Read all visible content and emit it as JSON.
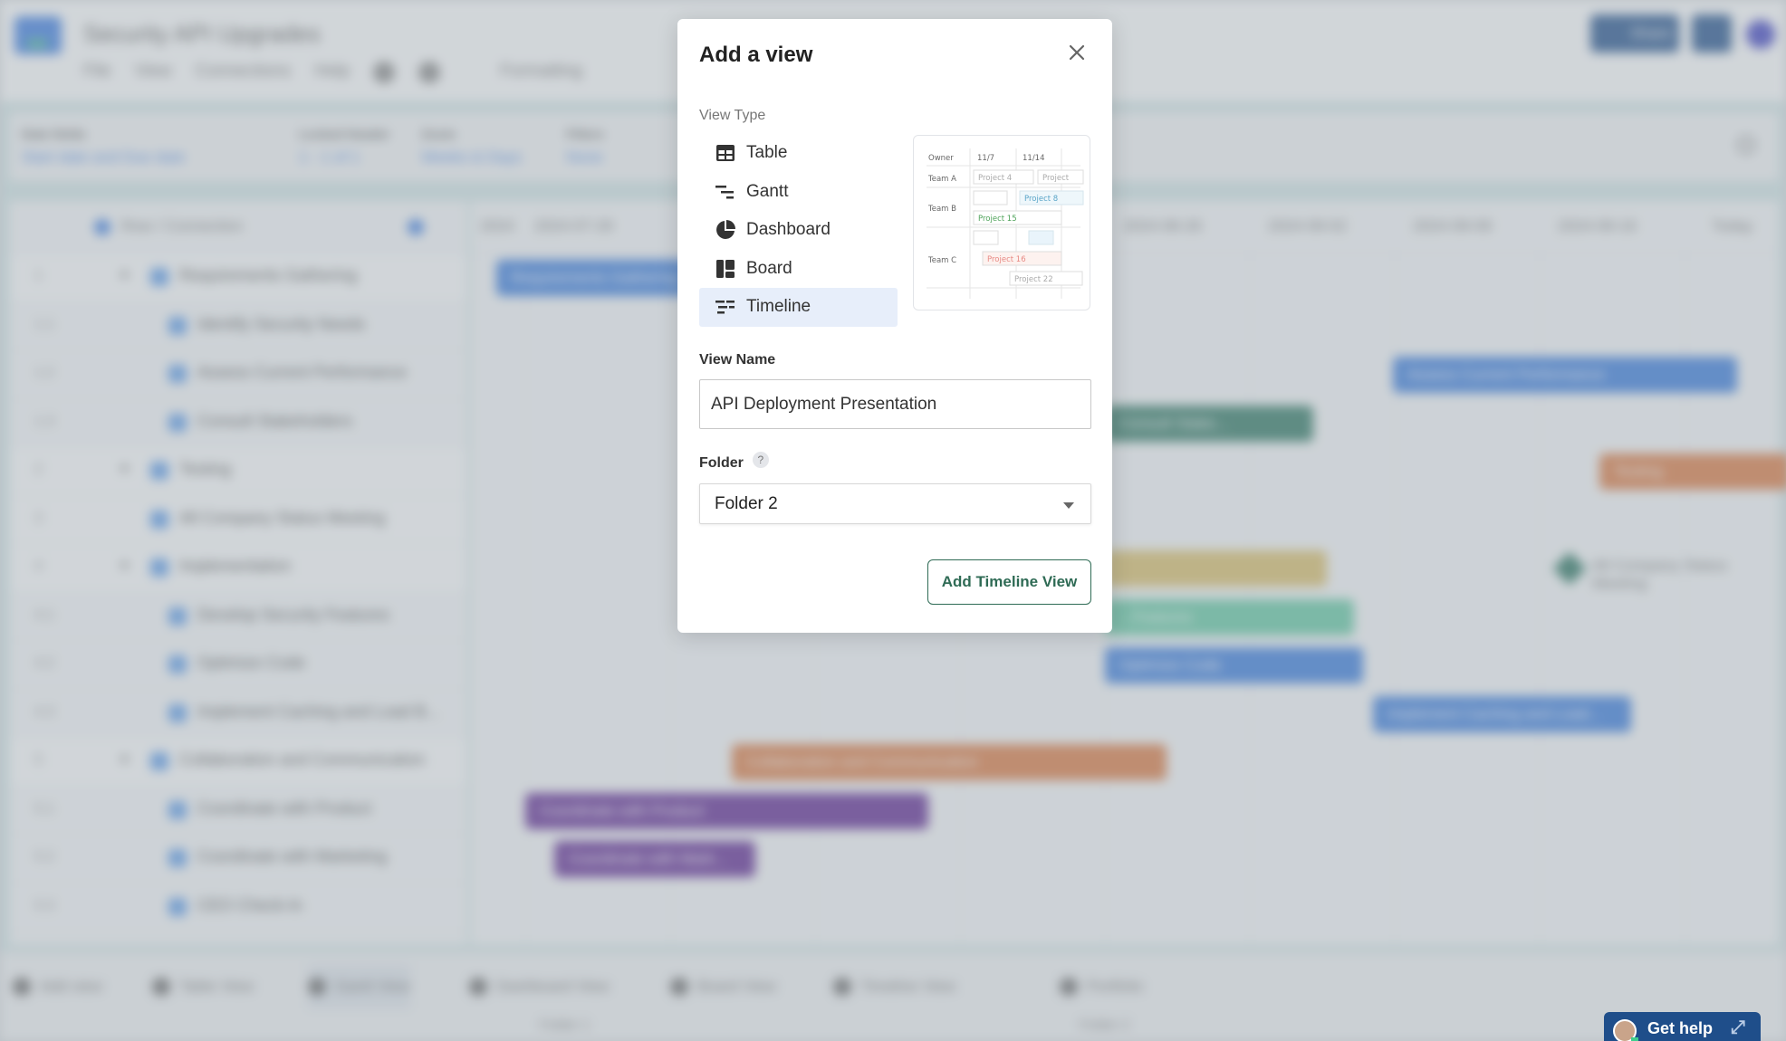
{
  "background": {
    "app_title": "Security API Upgrades",
    "menu": [
      "File",
      "View",
      "Connections",
      "Help"
    ],
    "toolbar": {
      "formatting_label": "Formatting"
    },
    "share_label": "Share",
    "filters": [
      {
        "label": "Date fields",
        "value": "Start date  and  Due date"
      },
      {
        "label": "Locked Header",
        "value": "1 - 1 of 1"
      },
      {
        "label": "Zoom",
        "value": "Weeks & Days"
      },
      {
        "label": "Filters",
        "value": "None"
      }
    ],
    "tasklist_header": "Row / Connection",
    "tasks": [
      {
        "num": "1",
        "name": "Requirements Gathering",
        "level": 0,
        "collapsible": true
      },
      {
        "num": "1.1",
        "name": "Identify Security Needs",
        "level": 1
      },
      {
        "num": "1.2",
        "name": "Assess Current Performance",
        "level": 1
      },
      {
        "num": "1.3",
        "name": "Consult Stakeholders",
        "level": 1
      },
      {
        "num": "2",
        "name": "Testing",
        "level": 0,
        "collapsible": true
      },
      {
        "num": "3",
        "name": "All Company Status Meeting",
        "level": 0
      },
      {
        "num": "4",
        "name": "Implementation",
        "level": 0,
        "collapsible": true
      },
      {
        "num": "4.1",
        "name": "Develop Security Features",
        "level": 1
      },
      {
        "num": "4.2",
        "name": "Optimize Code",
        "level": 1
      },
      {
        "num": "4.3",
        "name": "Implement Caching and Load B...",
        "level": 1
      },
      {
        "num": "5",
        "name": "Collaboration and Communication",
        "level": 0,
        "collapsible": true
      },
      {
        "num": "5.1",
        "name": "Coordinate with Product",
        "level": 1
      },
      {
        "num": "5.2",
        "name": "Coordinate with Marketing",
        "level": 1
      },
      {
        "num": "5.3",
        "name": "CEO Check-In",
        "level": 1
      }
    ],
    "gantt_dates": [
      "2024",
      "2024-07-29",
      "2024-08-26",
      "2024-09-02",
      "2024-09-09",
      "2024-09-16"
    ],
    "today_label": "Today",
    "bars": [
      {
        "label": "Requirements Gathering",
        "color": "#3478db"
      },
      {
        "label": "Assess Current Performance",
        "color": "#3478db"
      },
      {
        "label": "Consult Stake...",
        "color": "#2b7560"
      },
      {
        "label": "Testing",
        "color": "#d9773f"
      },
      {
        "label": "All Company Status Meeting",
        "color": "#2b7560"
      },
      {
        "label": "",
        "color": "#d8bc67"
      },
      {
        "label": "...Features",
        "color": "#5fc6a0"
      },
      {
        "label": "Optimize Code",
        "color": "#3478db"
      },
      {
        "label": "Implement Caching and Load...",
        "color": "#3478db"
      },
      {
        "label": "Collaboration and Communication",
        "color": "#d9773f"
      },
      {
        "label": "Coordinate with Product",
        "color": "#5b2390"
      },
      {
        "label": "Coordinate with Mark...",
        "color": "#5b2390"
      }
    ],
    "bottom_tabs": [
      {
        "label": "Add view"
      },
      {
        "label": "Table View"
      },
      {
        "label": "Gantt View",
        "active": true
      },
      {
        "label": "Dashboard View"
      },
      {
        "label": "Board View"
      },
      {
        "label": "Timeline View"
      },
      {
        "label": "Portfolio"
      }
    ],
    "folder_labels": [
      "Folder 1",
      "Folder 2"
    ]
  },
  "modal": {
    "title": "Add a view",
    "view_type_label": "View Type",
    "view_types": [
      {
        "label": "Table",
        "icon": "table-icon"
      },
      {
        "label": "Gantt",
        "icon": "gantt-icon"
      },
      {
        "label": "Dashboard",
        "icon": "dashboard-icon"
      },
      {
        "label": "Board",
        "icon": "board-icon"
      },
      {
        "label": "Timeline",
        "icon": "timeline-icon",
        "selected": true
      }
    ],
    "preview": {
      "owner_header": "Owner",
      "dates": [
        "11/7",
        "11/14"
      ],
      "teams": [
        "Team A",
        "Team B",
        "Team C"
      ],
      "projects": [
        "Project 4",
        "Project",
        "Project 8",
        "Project 15",
        "Project 16",
        "Project 22"
      ]
    },
    "view_name_label": "View Name",
    "view_name_value": "API Deployment Presentation",
    "folder_label": "Folder",
    "folder_help": "?",
    "folder_value": "Folder 2",
    "submit_label": "Add Timeline View"
  },
  "get_help": {
    "label": "Get help"
  },
  "colors": {
    "accent_green": "#2f6b55",
    "selected_bg": "#e7eefa",
    "brand_blue": "#1f4e8a"
  }
}
